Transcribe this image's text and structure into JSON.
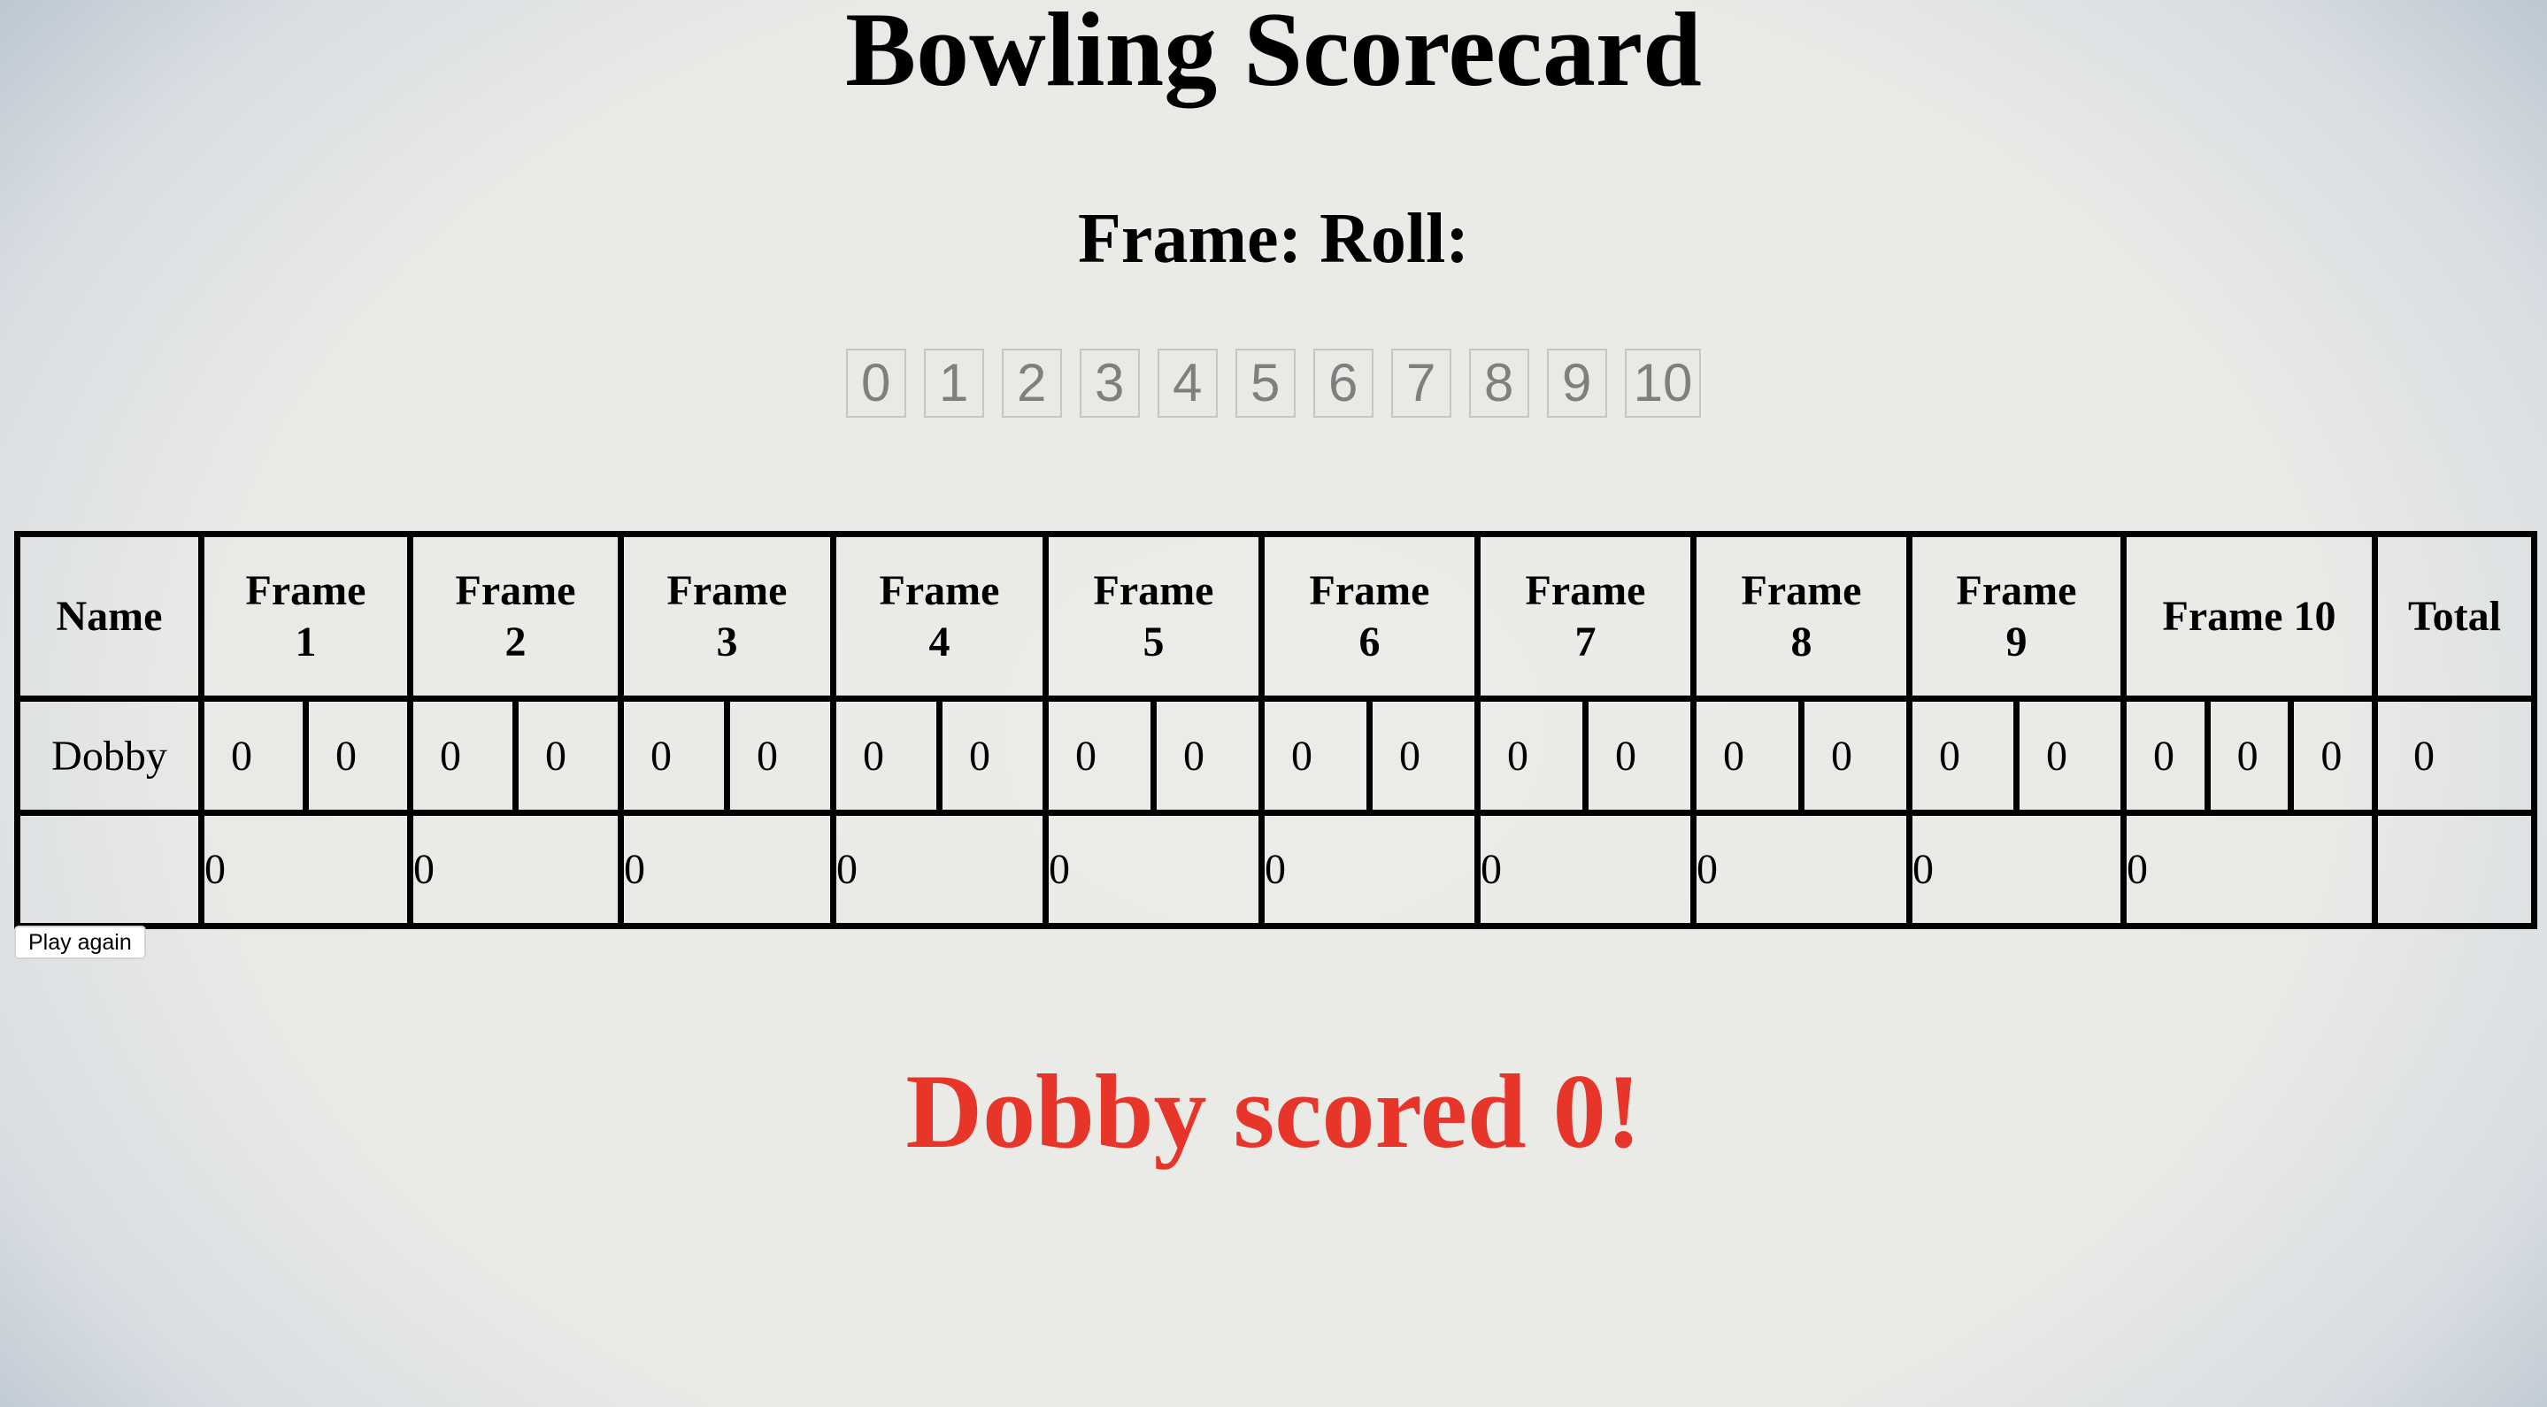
{
  "title": "Bowling Scorecard",
  "status": {
    "frame_label": "Frame:",
    "roll_label": "Roll:"
  },
  "pins": [
    "0",
    "1",
    "2",
    "3",
    "4",
    "5",
    "6",
    "7",
    "8",
    "9",
    "10"
  ],
  "table": {
    "headers": {
      "name": "Name",
      "frames": [
        [
          "Frame",
          "1"
        ],
        [
          "Frame",
          "2"
        ],
        [
          "Frame",
          "3"
        ],
        [
          "Frame",
          "4"
        ],
        [
          "Frame",
          "5"
        ],
        [
          "Frame",
          "6"
        ],
        [
          "Frame",
          "7"
        ],
        [
          "Frame",
          "8"
        ],
        [
          "Frame",
          "9"
        ],
        [
          "Frame 10",
          ""
        ]
      ],
      "total": "Total"
    },
    "player": {
      "name": "Dobby",
      "rolls": [
        [
          "0",
          "0"
        ],
        [
          "0",
          "0"
        ],
        [
          "0",
          "0"
        ],
        [
          "0",
          "0"
        ],
        [
          "0",
          "0"
        ],
        [
          "0",
          "0"
        ],
        [
          "0",
          "0"
        ],
        [
          "0",
          "0"
        ],
        [
          "0",
          "0"
        ],
        [
          "0",
          "0",
          "0"
        ]
      ],
      "frame_scores": [
        "0",
        "0",
        "0",
        "0",
        "0",
        "0",
        "0",
        "0",
        "0",
        "0"
      ],
      "total": "0"
    }
  },
  "play_again_label": "Play again",
  "result_message": "Dobby scored 0!",
  "colors": {
    "result_text": "#e8352a"
  }
}
